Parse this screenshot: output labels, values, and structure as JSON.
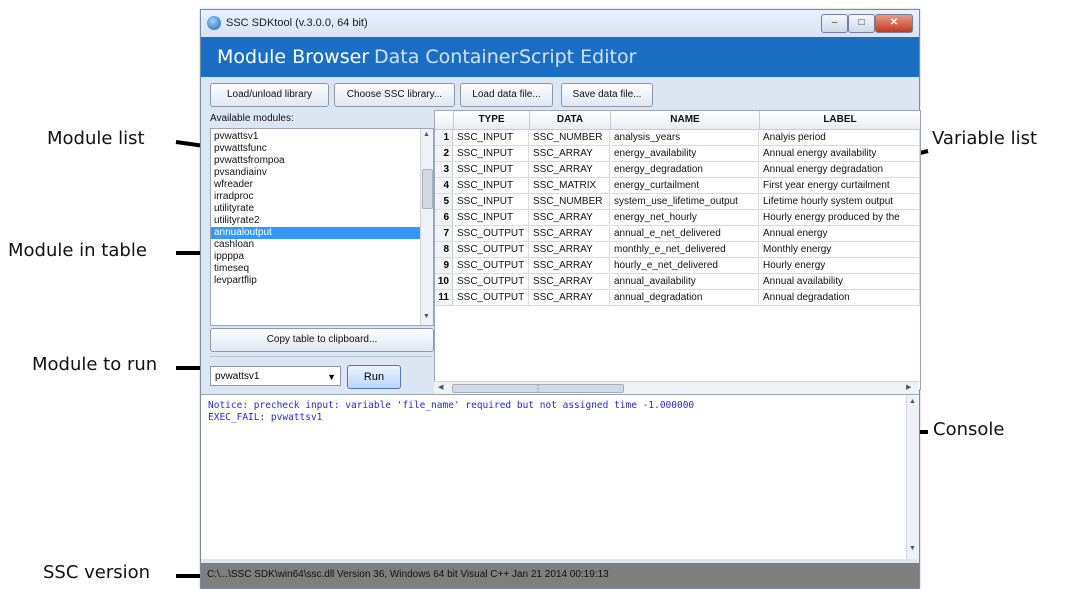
{
  "window": {
    "title": "SSC SDKtool (v.3.0.0, 64 bit)",
    "controls": {
      "minimize": "–",
      "maximize": "□",
      "close": "✕"
    }
  },
  "tabs": [
    {
      "label": "Module Browser",
      "active": true
    },
    {
      "label": "Data Container",
      "active": false
    },
    {
      "label": "Script Editor",
      "active": false
    }
  ],
  "toolbar": {
    "load_unload": "Load/unload library",
    "choose_lib": "Choose SSC library...",
    "load_data": "Load data file...",
    "save_data": "Save data file..."
  },
  "modules": {
    "label": "Available modules:",
    "items": [
      "pvwattsv1",
      "pvwattsfunc",
      "pvwattsfrompoa",
      "pvsandiainv",
      "wfreader",
      "irradproc",
      "utilityrate",
      "utilityrate2",
      "annualoutput",
      "cashloan",
      "ippppa",
      "timeseq",
      "levpartflip"
    ],
    "selected": "annualoutput"
  },
  "copy_button": "Copy table to clipboard...",
  "run_panel": {
    "selected_module": "pvwattsv1",
    "run_label": "Run"
  },
  "table": {
    "headers": [
      "TYPE",
      "DATA",
      "NAME",
      "LABEL"
    ],
    "rows": [
      [
        "1",
        "SSC_INPUT",
        "SSC_NUMBER",
        "analysis_years",
        "Analyis period"
      ],
      [
        "2",
        "SSC_INPUT",
        "SSC_ARRAY",
        "energy_availability",
        "Annual energy availability"
      ],
      [
        "3",
        "SSC_INPUT",
        "SSC_ARRAY",
        "energy_degradation",
        "Annual energy degradation"
      ],
      [
        "4",
        "SSC_INPUT",
        "SSC_MATRIX",
        "energy_curtailment",
        "First year energy curtailment"
      ],
      [
        "5",
        "SSC_INPUT",
        "SSC_NUMBER",
        "system_use_lifetime_output",
        "Lifetime hourly system output"
      ],
      [
        "6",
        "SSC_INPUT",
        "SSC_ARRAY",
        "energy_net_hourly",
        "Hourly energy produced by the"
      ],
      [
        "7",
        "SSC_OUTPUT",
        "SSC_ARRAY",
        "annual_e_net_delivered",
        "Annual energy"
      ],
      [
        "8",
        "SSC_OUTPUT",
        "SSC_ARRAY",
        "monthly_e_net_delivered",
        "Monthly energy"
      ],
      [
        "9",
        "SSC_OUTPUT",
        "SSC_ARRAY",
        "hourly_e_net_delivered",
        "Hourly energy"
      ],
      [
        "10",
        "SSC_OUTPUT",
        "SSC_ARRAY",
        "annual_availability",
        "Annual availability"
      ],
      [
        "11",
        "SSC_OUTPUT",
        "SSC_ARRAY",
        "annual_degradation",
        "Annual degradation"
      ]
    ]
  },
  "console": {
    "lines": [
      "Notice: precheck input: variable 'file_name' required but not assigned time -1.000000",
      "EXEC_FAIL: pvwattsv1"
    ]
  },
  "status": "C:\\...\\SSC SDK\\win64\\ssc.dll Version 36, Windows 64 bit Visual C++ Jan 21 2014 00:19:13",
  "annotations": {
    "module_list": "Module list",
    "module_in_table": "Module in table",
    "module_to_run": "Module to run",
    "ssc_version": "SSC version",
    "variable_list": "Variable list",
    "console": "Console"
  }
}
